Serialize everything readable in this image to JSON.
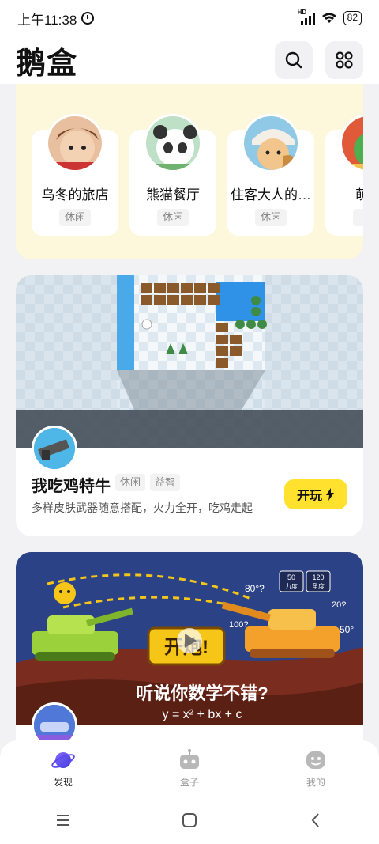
{
  "status_bar": {
    "time": "上午11:38",
    "battery": "82",
    "network": "HD"
  },
  "header": {
    "logo": "鹅盒",
    "search_icon": "search-icon",
    "apps_icon": "grid-icon"
  },
  "featured": {
    "items": [
      {
        "title": "乌冬的旅店",
        "tag": "休闲"
      },
      {
        "title": "熊猫餐厅",
        "tag": "休闲"
      },
      {
        "title": "住客大人的…",
        "tag": "休闲"
      },
      {
        "title": "萌萌",
        "tag": "休"
      }
    ]
  },
  "games": [
    {
      "title": "我吃鸡特牛",
      "tags": [
        "休闲",
        "益智"
      ],
      "desc": "多样皮肤武器随意搭配，火力全开，吃鸡走起",
      "button": "开玩"
    },
    {
      "banner_text": "听说你数学不错?",
      "banner_formula": "y = x² + bx + c",
      "banner_button": "开炮!",
      "banner_stats": [
        "50",
        "力度",
        "120",
        "角度"
      ],
      "angle_labels": [
        "80°?",
        "100?",
        "50°",
        "20?"
      ]
    }
  ],
  "bottom_nav": [
    {
      "label": "发现",
      "icon": "planet-icon",
      "active": true
    },
    {
      "label": "盒子",
      "icon": "robot-icon",
      "active": false
    },
    {
      "label": "我的",
      "icon": "face-icon",
      "active": false
    }
  ],
  "colors": {
    "accent": "#ffe12e",
    "panel": "#fdf7dc",
    "background": "#f2f2f4"
  }
}
